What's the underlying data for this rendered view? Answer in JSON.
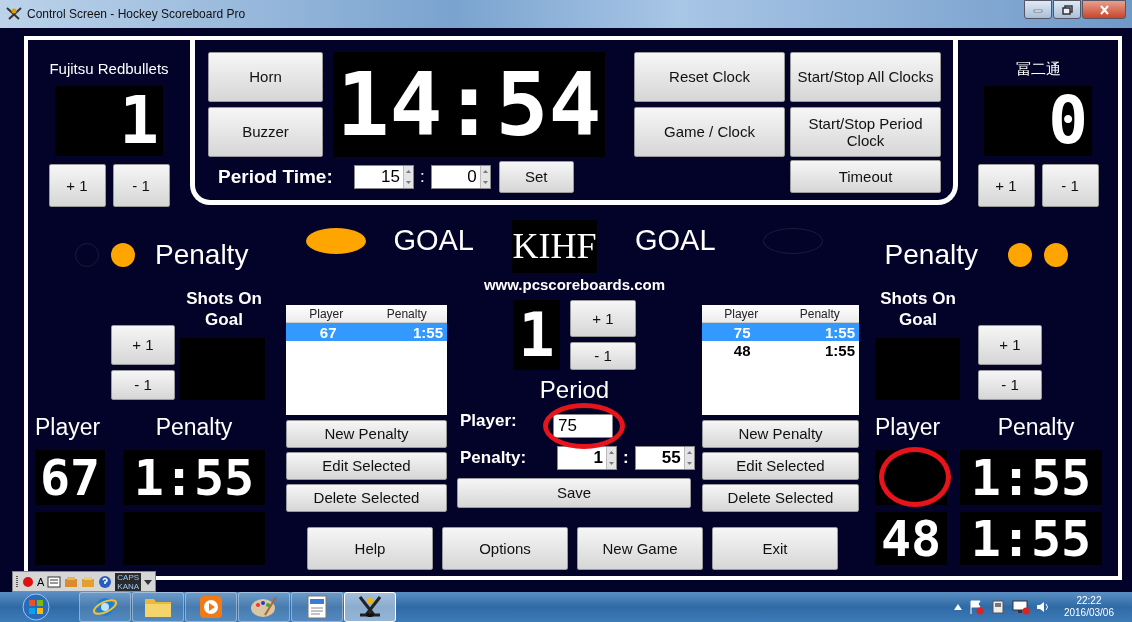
{
  "window": {
    "title": "Control Screen - Hockey Scoreboard Pro"
  },
  "clock": {
    "time": "14:54",
    "buttons_left": [
      "Horn",
      "Buzzer"
    ],
    "buttons_right": [
      "Reset Clock",
      "Start/Stop All Clocks",
      "Game / Clock",
      "Start/Stop Period Clock",
      "Timeout"
    ],
    "period_time_label": "Period Time:",
    "minutes": "15",
    "separator": ":",
    "seconds": "0",
    "set": "Set"
  },
  "teams": [
    {
      "name": "Fujitsu Redbullets",
      "score": "1",
      "plus": "+ 1",
      "minus": "- 1",
      "penalty_label": "Penalty",
      "penalty_lamps": [
        {
          "on": false
        },
        {
          "on": true
        }
      ],
      "goal_label": "GOAL",
      "goal_lamp_on": true,
      "shots_label": "Shots On Goal",
      "shots_plus": "+ 1",
      "shots_minus": "- 1",
      "player_label": "Player",
      "penalty_col_label": "Penalty",
      "penalty_slots": [
        {
          "player": "67",
          "time": "1:55",
          "circled": false
        },
        {
          "circled": false
        }
      ],
      "list": {
        "columns": [
          "Player",
          "Penalty"
        ],
        "rows": [
          {
            "player": "67",
            "penalty": "1:55",
            "selected": true
          }
        ]
      },
      "list_buttons": [
        "New Penalty",
        "Edit Selected",
        "Delete Selected"
      ]
    },
    {
      "name": "冨二通",
      "score": "0",
      "plus": "+ 1",
      "minus": "- 1",
      "penalty_label": "Penalty",
      "penalty_lamps": [
        {
          "on": true
        },
        {
          "on": true
        }
      ],
      "goal_label": "GOAL",
      "goal_lamp_on": false,
      "shots_label": "Shots On Goal",
      "shots_plus": "+ 1",
      "shots_minus": "- 1",
      "player_label": "Player",
      "penalty_col_label": "Penalty",
      "penalty_slots": [
        {
          "time": "1:55",
          "circled": true
        },
        {
          "player": "48",
          "time": "1:55",
          "circled": false
        }
      ],
      "list": {
        "columns": [
          "Player",
          "Penalty"
        ],
        "rows": [
          {
            "player": "75",
            "penalty": "1:55",
            "selected": true
          },
          {
            "player": "48",
            "penalty": "1:55",
            "selected": false
          }
        ]
      },
      "list_buttons": [
        "New Penalty",
        "Edit Selected",
        "Delete Selected"
      ]
    }
  ],
  "logo": "KIHF",
  "url": "www.pcscoreboards.com",
  "period": {
    "value": "1",
    "plus": "+ 1",
    "minus": "- 1",
    "label": "Period"
  },
  "editor": {
    "player_label": "Player:",
    "player": "75",
    "player_circled": true,
    "penalty_label": "Penalty:",
    "minutes": "1",
    "separator": ":",
    "seconds": "55",
    "save": "Save"
  },
  "bottom_buttons": [
    "Help",
    "Options",
    "New Game",
    "Exit"
  ],
  "ime": {
    "mode": "A",
    "caps": "CAPS",
    "kana": "KANA"
  },
  "taskbar": {
    "apps": [
      {
        "kind": "browser",
        "selected": false
      },
      {
        "kind": "folder",
        "selected": false
      },
      {
        "kind": "media",
        "selected": false
      },
      {
        "kind": "paint",
        "selected": false
      },
      {
        "kind": "document",
        "selected": false
      },
      {
        "kind": "hockey",
        "selected": true
      }
    ],
    "time": "22:22",
    "date": "2016/03/06"
  }
}
